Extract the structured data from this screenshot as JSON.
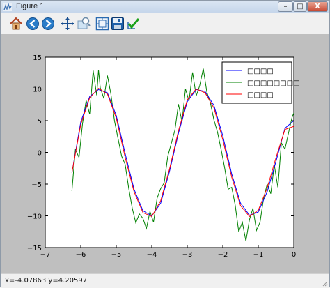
{
  "window": {
    "title": "Figure 1",
    "controls": {
      "minimize": "–",
      "maximize": "□",
      "close": "X"
    }
  },
  "toolbar": {
    "buttons": [
      {
        "name": "home",
        "icon": "home-icon"
      },
      {
        "name": "back",
        "icon": "arrow-left-icon"
      },
      {
        "name": "forward",
        "icon": "arrow-right-icon"
      },
      {
        "name": "pan",
        "icon": "move-icon"
      },
      {
        "name": "zoom",
        "icon": "zoom-rect-icon"
      },
      {
        "name": "subplots",
        "icon": "subplots-icon"
      },
      {
        "name": "save",
        "icon": "floppy-icon"
      },
      {
        "name": "edit",
        "icon": "checkmark-icon"
      }
    ]
  },
  "status": {
    "text": "x=-4.07863     y=4.20597"
  },
  "chart_data": {
    "type": "line",
    "xlim": [
      -7,
      0
    ],
    "ylim": [
      -15,
      15
    ],
    "x_ticks": [
      "−7",
      "−6",
      "−5",
      "−4",
      "−3",
      "−2",
      "−1",
      "0"
    ],
    "y_ticks": [
      "15",
      "10",
      "5",
      "0",
      "−5",
      "−10",
      "−15"
    ],
    "x_tick_values": [
      -7,
      -6,
      -5,
      -4,
      -3,
      -2,
      -1,
      0
    ],
    "y_tick_values": [
      15,
      10,
      5,
      0,
      -5,
      -10,
      -15
    ],
    "legend_position": "top-right",
    "legend_labels": [
      "□□□□",
      "□□□□□□□□",
      "□□□□"
    ],
    "series": [
      {
        "color": "#0000ff",
        "x": [
          -6.25,
          -6.0,
          -5.75,
          -5.5,
          -5.25,
          -5.0,
          -4.75,
          -4.5,
          -4.25,
          -4.0,
          -3.75,
          -3.5,
          -3.25,
          -3.0,
          -2.75,
          -2.5,
          -2.25,
          -2.0,
          -1.75,
          -1.5,
          -1.25,
          -1.0,
          -0.75,
          -0.5,
          -0.25,
          0.0
        ],
        "y": [
          -3.2,
          4.8,
          8.8,
          9.9,
          9.4,
          5.8,
          -0.2,
          -5.8,
          -9.2,
          -10.0,
          -8.0,
          -3.0,
          3.0,
          8.0,
          9.9,
          9.6,
          7.4,
          2.6,
          -3.4,
          -8.0,
          -9.9,
          -9.4,
          -6.2,
          -1.4,
          3.8,
          5.0
        ]
      },
      {
        "color": "#008000",
        "x": [
          -6.25,
          -6.15,
          -6.05,
          -5.95,
          -5.85,
          -5.75,
          -5.65,
          -5.55,
          -5.5,
          -5.45,
          -5.35,
          -5.25,
          -5.15,
          -5.05,
          -4.95,
          -4.85,
          -4.75,
          -4.65,
          -4.55,
          -4.45,
          -4.35,
          -4.25,
          -4.15,
          -4.05,
          -3.95,
          -3.85,
          -3.75,
          -3.65,
          -3.55,
          -3.45,
          -3.35,
          -3.25,
          -3.15,
          -3.05,
          -2.95,
          -2.85,
          -2.75,
          -2.65,
          -2.55,
          -2.45,
          -2.35,
          -2.25,
          -2.15,
          -2.05,
          -1.95,
          -1.85,
          -1.75,
          -1.65,
          -1.55,
          -1.45,
          -1.35,
          -1.25,
          -1.15,
          -1.05,
          -0.95,
          -0.85,
          -0.75,
          -0.65,
          -0.55,
          -0.45,
          -0.35,
          -0.25,
          -0.15,
          -0.05,
          0.0
        ],
        "y": [
          -6.1,
          0.5,
          -0.8,
          4.5,
          8.2,
          6.0,
          12.9,
          9.0,
          13.0,
          10.2,
          8.5,
          12.1,
          9.2,
          5.0,
          2.2,
          -0.6,
          -1.9,
          -5.6,
          -8.8,
          -11.1,
          -9.7,
          -10.4,
          -12.0,
          -9.3,
          -11.0,
          -7.2,
          -5.7,
          -4.8,
          -0.6,
          1.4,
          3.5,
          7.6,
          4.8,
          10.0,
          8.1,
          12.6,
          8.9,
          10.5,
          13.2,
          9.5,
          7.8,
          5.1,
          3.2,
          0.5,
          -2.4,
          -5.8,
          -5.5,
          -8.3,
          -12.5,
          -11.0,
          -14.0,
          -10.6,
          -8.8,
          -12.3,
          -11.0,
          -7.2,
          -5.0,
          -6.5,
          -2.0,
          -5.5,
          1.5,
          0.5,
          3.0,
          5.5,
          6.2
        ]
      },
      {
        "color": "#ff0000",
        "x": [
          -6.25,
          -6.0,
          -5.75,
          -5.5,
          -5.25,
          -5.0,
          -4.75,
          -4.5,
          -4.25,
          -4.0,
          -3.75,
          -3.5,
          -3.25,
          -3.0,
          -2.75,
          -2.5,
          -2.25,
          -2.0,
          -1.75,
          -1.5,
          -1.25,
          -1.0,
          -0.75,
          -0.5,
          -0.25,
          0.0
        ],
        "y": [
          -3.2,
          4.4,
          8.6,
          10.1,
          9.2,
          5.4,
          -0.8,
          -6.2,
          -9.5,
          -10.1,
          -7.6,
          -2.6,
          3.4,
          8.3,
          10.0,
          9.4,
          7.0,
          2.0,
          -3.9,
          -8.4,
          -10.1,
          -9.1,
          -5.6,
          -0.8,
          3.6,
          4.1
        ]
      }
    ]
  }
}
